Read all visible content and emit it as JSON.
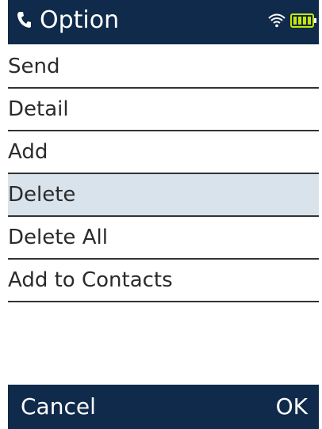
{
  "header": {
    "icon": "phone-icon",
    "title": "Option",
    "status_icons": [
      "wifi-icon",
      "battery-icon"
    ]
  },
  "menu": {
    "items": [
      {
        "label": "Send",
        "selected": false
      },
      {
        "label": "Detail",
        "selected": false
      },
      {
        "label": "Add",
        "selected": false
      },
      {
        "label": "Delete",
        "selected": true
      },
      {
        "label": "Delete All",
        "selected": false
      },
      {
        "label": "Add to Contacts",
        "selected": false
      }
    ]
  },
  "softkeys": {
    "left": "Cancel",
    "right": "OK"
  },
  "colors": {
    "bar": "#0f2a4a",
    "selected_row": "#d8e3ec",
    "battery": "#c8e600",
    "wifi": "#ffffff"
  }
}
